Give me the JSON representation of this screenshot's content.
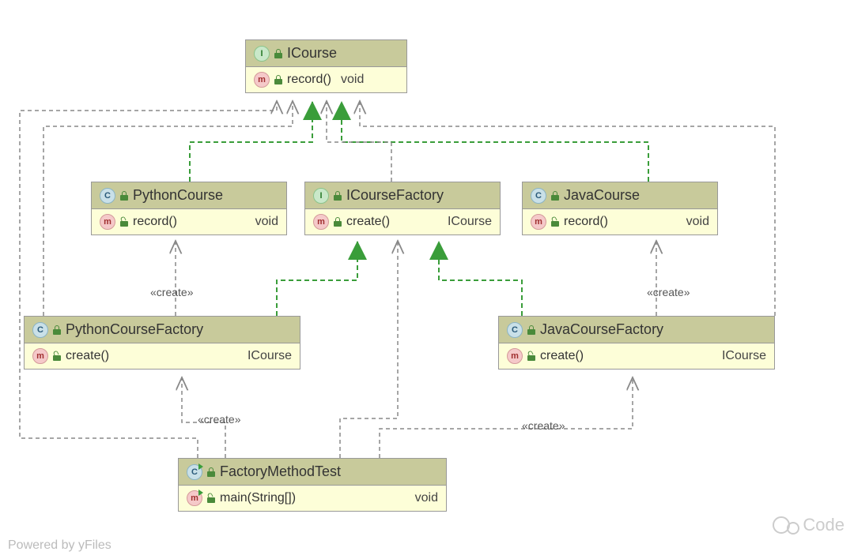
{
  "footer": "Powered by yFiles",
  "watermark": "Code",
  "edgeLabels": {
    "create1": "«create»",
    "create2": "«create»",
    "create3": "«create»",
    "create4": "«create»"
  },
  "classes": {
    "icourse": {
      "badge": "I",
      "name": "ICourse",
      "members": [
        {
          "badge": "m",
          "name": "record()",
          "ret": "void"
        }
      ]
    },
    "pythoncourse": {
      "badge": "C",
      "name": "PythonCourse",
      "members": [
        {
          "badge": "m",
          "name": "record()",
          "ret": "void"
        }
      ]
    },
    "icoursefactory": {
      "badge": "I",
      "name": "ICourseFactory",
      "members": [
        {
          "badge": "m",
          "name": "create()",
          "ret": "ICourse"
        }
      ]
    },
    "javacourse": {
      "badge": "C",
      "name": "JavaCourse",
      "members": [
        {
          "badge": "m",
          "name": "record()",
          "ret": "void"
        }
      ]
    },
    "pythoncoursefactory": {
      "badge": "C",
      "name": "PythonCourseFactory",
      "members": [
        {
          "badge": "m",
          "name": "create()",
          "ret": "ICourse"
        }
      ]
    },
    "javacoursefactory": {
      "badge": "C",
      "name": "JavaCourseFactory",
      "members": [
        {
          "badge": "m",
          "name": "create()",
          "ret": "ICourse"
        }
      ]
    },
    "factorymethodtest": {
      "badge": "C",
      "name": "FactoryMethodTest",
      "members": [
        {
          "badge": "m",
          "name": "main(String[])",
          "ret": "void"
        }
      ]
    }
  }
}
